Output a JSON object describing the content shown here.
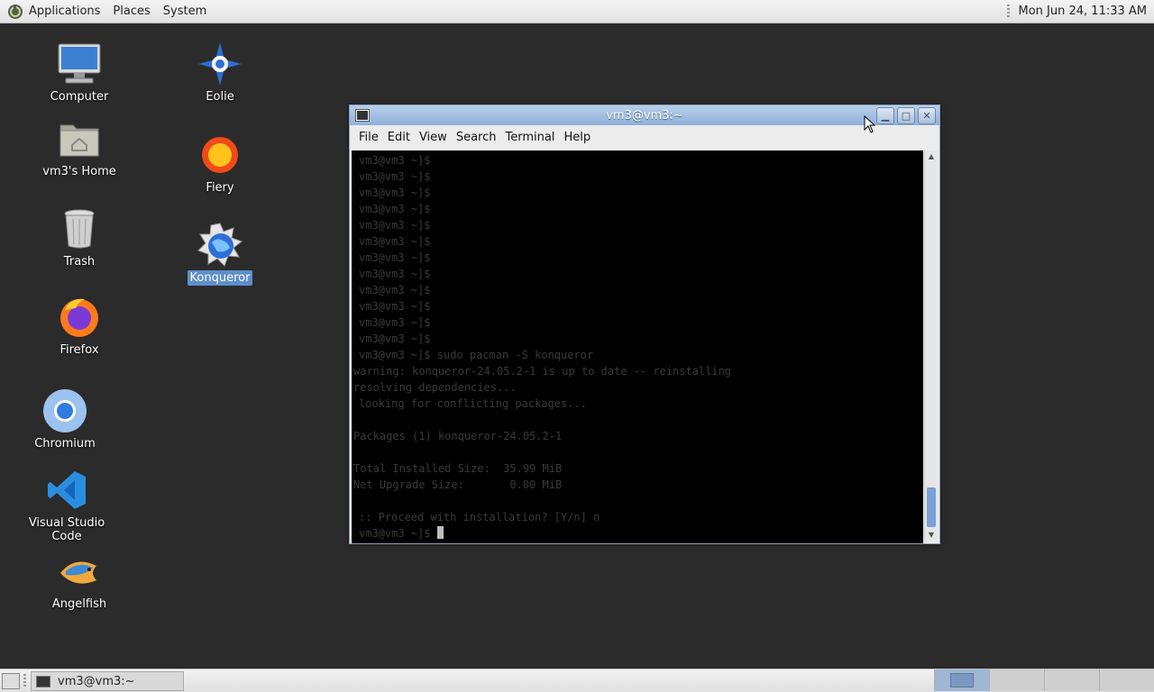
{
  "top_panel": {
    "menus": [
      "Applications",
      "Places",
      "System"
    ],
    "clock": "Mon Jun 24, 11:33 AM"
  },
  "desktop_icons": {
    "computer": "Computer",
    "home": "vm3's Home",
    "trash": "Trash",
    "firefox": "Firefox",
    "chromium": "Chromium",
    "vscode": "Visual Studio Code",
    "angelfish": "Angelfish",
    "eolie": "Eolie",
    "fiery": "Fiery",
    "konqueror": "Konqueror"
  },
  "terminal": {
    "title": "vm3@vm3:~",
    "menu": [
      "File",
      "Edit",
      "View",
      "Search",
      "Terminal",
      "Help"
    ],
    "lines": [
      "vm3@vm3 ~]$",
      "vm3@vm3 ~]$",
      "vm3@vm3 ~]$",
      "vm3@vm3 ~]$",
      "vm3@vm3 ~]$",
      "vm3@vm3 ~]$",
      "vm3@vm3 ~]$",
      "vm3@vm3 ~]$",
      "vm3@vm3 ~]$",
      "vm3@vm3 ~]$",
      "vm3@vm3 ~]$",
      "vm3@vm3 ~]$",
      "vm3@vm3 ~]$ sudo pacman -S konqueror",
      "warning: konqueror-24.05.2-1 is up to date -- reinstalling",
      "resolving dependencies...",
      "looking for conflicting packages...",
      "",
      "Packages (1) konqueror-24.05.2-1",
      "",
      "Total Installed Size:  35.99 MiB",
      "Net Upgrade Size:       0.00 MiB",
      "",
      ":: Proceed with installation? [Y/n] n",
      "vm3@vm3 ~]$ "
    ]
  },
  "taskbar": {
    "task_label": "vm3@vm3:~"
  }
}
